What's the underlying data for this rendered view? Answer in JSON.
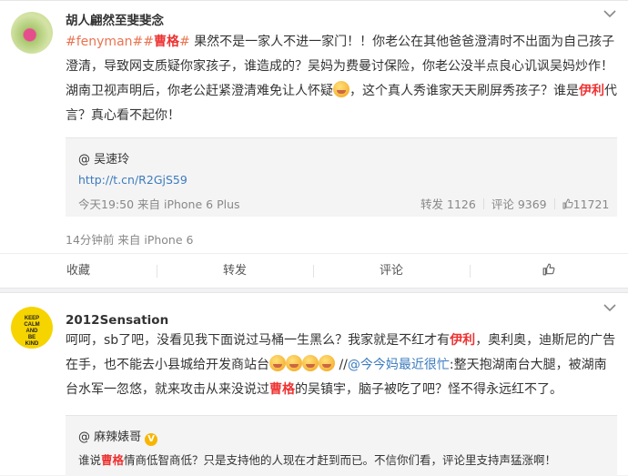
{
  "post1": {
    "username": "胡人翩然至斐斐念",
    "content": {
      "hashtag1": "#fenyman#",
      "hashtag2_open": "#",
      "hashtag2_name": "曹格",
      "hashtag2_close": "#",
      "text1": " 果然不是一家人不进一家门！！你老公在其他爸爸澄清时不出面为自己孩子澄清，导致网支质疑你家孩子，谁造成的？吴妈为费曼讨保险，你老公没半点良心讥讽吴妈炒作！湖南卫视声明后，你老公赶紧澄清难免让人怀疑",
      "text2": "，这个真人秀谁家天天刷屏秀孩子？谁是",
      "brand": "伊利",
      "text3": "代言？真心看不起你！"
    },
    "repost": {
      "user": "@ 吴速玲",
      "link": "http://t.cn/R2GjS59",
      "meta": "今天19:50 来自 iPhone 6 Plus",
      "reposts_label": "转发",
      "reposts": "1126",
      "comments_label": "评论",
      "comments": "9369",
      "likes": "11721"
    },
    "meta": "14分钟前 来自 iPhone 6",
    "actions": {
      "favorite": "收藏",
      "repost": "转发",
      "comment": "评论"
    }
  },
  "post2": {
    "username": "2012Sensation",
    "avatar_text": "KEEP\nCALM\nAND\nBE\nKIND",
    "content": {
      "text1": "呵呵，sb了吧，没看见我下面说过马桶一生黑么？我家就是不红才有",
      "brand": "伊利",
      "text2": "，奥利奥，迪斯尼的广告在手，也不能去小县城给开发商站台",
      "sep": " //",
      "mention": "@今今妈最近很忙",
      "text3": ":整天抱湖南台大腿，被湖南台水军一忽悠，就来攻击从来没说过",
      "name": "曹格",
      "text4": "的吴镇宇，脑子被吃了吧？怪不得永远红不了。"
    },
    "repost": {
      "user": "@ 麻辣婊哥",
      "verified": "V",
      "text1": "谁说",
      "name": "曹格",
      "text2": "情商低智商低？只是支持他的人现在才赶到而已。不信你们看，评论里支持声猛涨啊！"
    }
  },
  "colors": {
    "accent_orange": "#eb7350",
    "link_blue": "#3b7bbf",
    "highlight_red": "#e33333"
  },
  "icons": [
    "chevron-down-icon",
    "thumbs-up-icon",
    "verified-badge-icon"
  ]
}
